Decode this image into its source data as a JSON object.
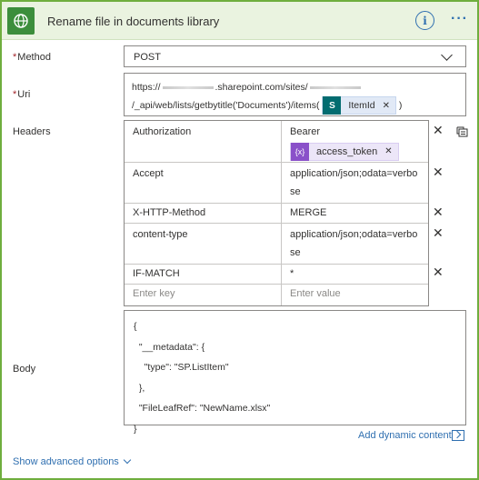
{
  "header": {
    "title": "Rename file in documents library",
    "icon": "globe-icon",
    "info_icon": "info-icon",
    "more_icon": "more-icon"
  },
  "method": {
    "label": "Method",
    "required_mark": "*",
    "value": "POST"
  },
  "uri": {
    "label": "Uri",
    "required_mark": "*",
    "part1": "https://",
    "part2": ".sharepoint.com/sites/",
    "part3": "/_api/web/lists/getbytitle('Documents')/items(",
    "token_label": "ItemId",
    "part4": ")"
  },
  "headers": {
    "label": "Headers",
    "rows": [
      {
        "key": "Authorization",
        "value": "Bearer",
        "token": "access_token"
      },
      {
        "key": "Accept",
        "value": "application/json;odata=verbose"
      },
      {
        "key": "X-HTTP-Method",
        "value": "MERGE"
      },
      {
        "key": "content-type",
        "value": "application/json;odata=verbose"
      },
      {
        "key": "IF-MATCH",
        "value": "*"
      }
    ],
    "key_placeholder": "Enter key",
    "value_placeholder": "Enter value"
  },
  "body": {
    "label": "Body",
    "text": "{\n  \"__metadata\": {\n    \"type\": \"SP.ListItem\"\n  },\n  \"FileLeafRef\": \"NewName.xlsx\"\n}"
  },
  "add_dynamic_content": "Add dynamic content",
  "show_advanced": "Show advanced options",
  "colors": {
    "accent_border": "#6fae3e",
    "header_bg": "#eaf3e0",
    "link": "#2f6fb0",
    "sharepoint": "#036c70",
    "expression": "#8a51c9"
  }
}
